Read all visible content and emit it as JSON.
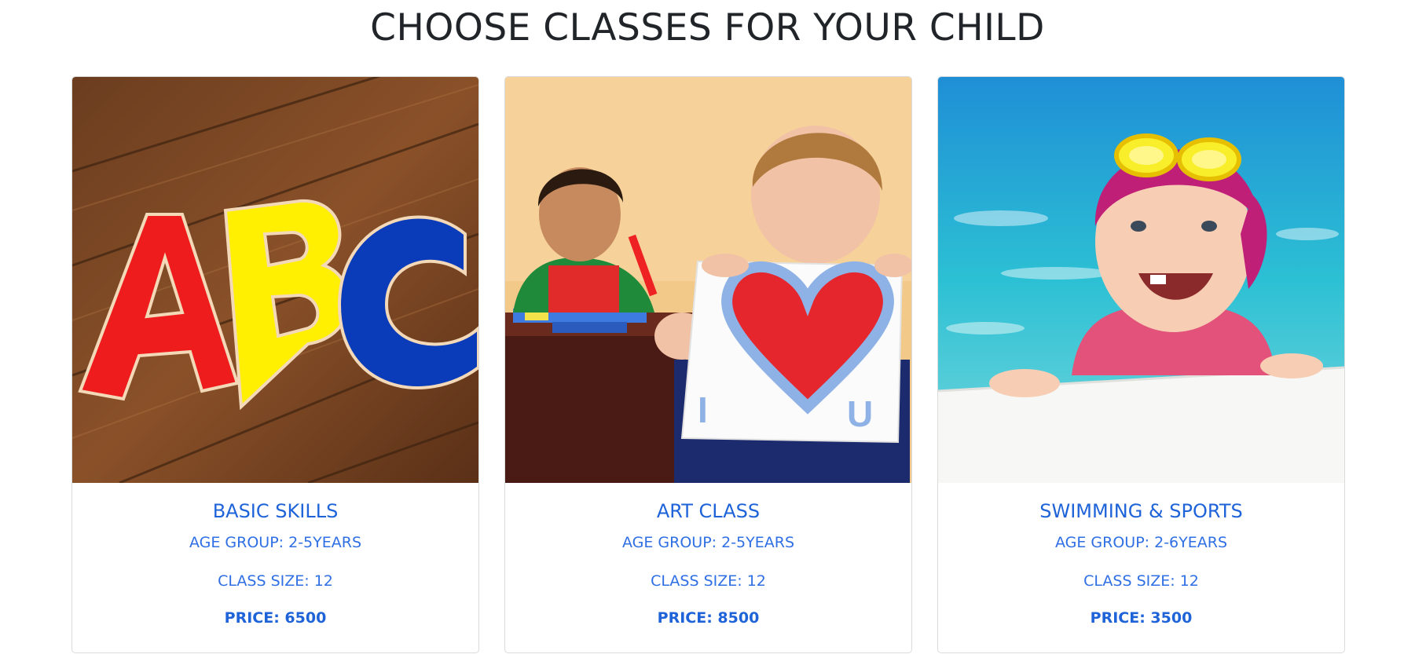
{
  "page": {
    "title": "CHOOSE CLASSES FOR YOUR CHILD"
  },
  "cards": [
    {
      "image": "abc-wooden-letters-photo",
      "title": "BASIC SKILLS",
      "age_group": "AGE GROUP: 2-5YEARS",
      "class_size": "CLASS SIZE: 12",
      "price": "PRICE: 6500"
    },
    {
      "image": "kids-art-class-photo",
      "title": "ART CLASS",
      "age_group": "AGE GROUP: 2-5YEARS",
      "class_size": "CLASS SIZE: 12",
      "price": "PRICE: 8500"
    },
    {
      "image": "baby-swimming-photo",
      "title": "SWIMMING & SPORTS",
      "age_group": "AGE GROUP: 2-6YEARS",
      "class_size": "CLASS SIZE: 12",
      "price": "PRICE: 3500"
    }
  ],
  "colors": {
    "accent": "#1f63d9",
    "heading": "#212529"
  }
}
